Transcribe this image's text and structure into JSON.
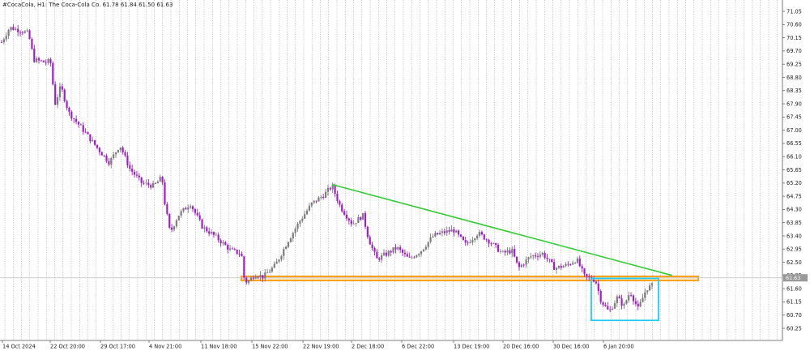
{
  "header": {
    "symbol": "#CocaCola, H1:",
    "description": "The Coca-Cola Co.",
    "ohlc": "61.78 61.84 61.50 61.63"
  },
  "colors": {
    "up": "#7d7d7d",
    "down": "#a020c8",
    "trendline": "#33cc33",
    "support_zone": "#ff9900",
    "support_fill": "#ffd8a0",
    "highlight_box": "#22ccee",
    "grid": "#9a9a9a",
    "axis_text": "#222222",
    "current_price_bg": "#9a9a9a"
  },
  "chart_data": {
    "type": "candlestick",
    "timeframe": "H1",
    "price_range": [
      60.05,
      71.45
    ],
    "y_ticks": [
      "71.05",
      "70.60",
      "70.15",
      "69.70",
      "69.25",
      "68.80",
      "68.35",
      "67.90",
      "67.45",
      "67.00",
      "66.55",
      "66.10",
      "65.65",
      "65.20",
      "64.75",
      "64.30",
      "63.85",
      "63.40",
      "62.95",
      "62.50",
      "62.05",
      "61.60",
      "61.15",
      "60.70",
      "60.25"
    ],
    "x_ticks": [
      "14 Oct 2024",
      "22 Oct 20:00",
      "29 Oct 17:00",
      "4 Nov 21:00",
      "11 Nov 18:00",
      "15 Nov 22:00",
      "22 Nov 19:00",
      "2 Dec 18:00",
      "6 Dec 22:00",
      "13 Dec 19:00",
      "20 Dec 16:00",
      "30 Dec 16:00",
      "6 Jan 20:00"
    ],
    "current_price": "61.63",
    "bar_count": 280,
    "path": [
      [
        0,
        69.9
      ],
      [
        12,
        70.5
      ],
      [
        25,
        70.4
      ],
      [
        35,
        70.3
      ],
      [
        42,
        69.4
      ],
      [
        58,
        69.3
      ],
      [
        62,
        69.4
      ],
      [
        68,
        67.9
      ],
      [
        75,
        68.5
      ],
      [
        85,
        67.6
      ],
      [
        100,
        67.1
      ],
      [
        120,
        66.4
      ],
      [
        135,
        65.9
      ],
      [
        148,
        66.5
      ],
      [
        160,
        65.7
      ],
      [
        175,
        65.2
      ],
      [
        190,
        65.1
      ],
      [
        200,
        65.4
      ],
      [
        203,
        64.6
      ],
      [
        210,
        63.5
      ],
      [
        220,
        64.1
      ],
      [
        235,
        64.5
      ],
      [
        250,
        63.7
      ],
      [
        265,
        63.4
      ],
      [
        285,
        62.9
      ],
      [
        298,
        62.8
      ],
      [
        301,
        62.0
      ],
      [
        305,
        61.8
      ],
      [
        315,
        62.1
      ],
      [
        325,
        62.0
      ],
      [
        340,
        62.4
      ],
      [
        355,
        63.2
      ],
      [
        370,
        63.9
      ],
      [
        385,
        64.5
      ],
      [
        400,
        64.8
      ],
      [
        410,
        65.1
      ],
      [
        420,
        64.4
      ],
      [
        435,
        63.8
      ],
      [
        448,
        64.1
      ],
      [
        455,
        63.3
      ],
      [
        465,
        62.6
      ],
      [
        478,
        62.8
      ],
      [
        490,
        63.0
      ],
      [
        505,
        62.6
      ],
      [
        520,
        62.9
      ],
      [
        535,
        63.4
      ],
      [
        545,
        63.5
      ],
      [
        560,
        63.6
      ],
      [
        575,
        63.1
      ],
      [
        590,
        63.5
      ],
      [
        605,
        63.2
      ],
      [
        620,
        62.8
      ],
      [
        632,
        62.9
      ],
      [
        640,
        62.3
      ],
      [
        655,
        62.7
      ],
      [
        670,
        62.8
      ],
      [
        685,
        62.3
      ],
      [
        700,
        62.4
      ],
      [
        712,
        62.6
      ],
      [
        722,
        62.0
      ],
      [
        735,
        61.9
      ],
      [
        742,
        61.2
      ],
      [
        752,
        60.8
      ],
      [
        762,
        61.3
      ],
      [
        770,
        61.0
      ],
      [
        778,
        61.5
      ],
      [
        788,
        60.9
      ],
      [
        798,
        61.6
      ],
      [
        805,
        61.7
      ]
    ],
    "annotations": {
      "trendline": {
        "from": [
          410,
          65.15
        ],
        "to": [
          830,
          62.05
        ]
      },
      "support_zone": {
        "from": 298,
        "to": 862,
        "high": 62.02,
        "low": 61.88
      },
      "highlight_box": {
        "from": 730,
        "to": 813,
        "high": 61.95,
        "low": 60.52
      }
    }
  }
}
